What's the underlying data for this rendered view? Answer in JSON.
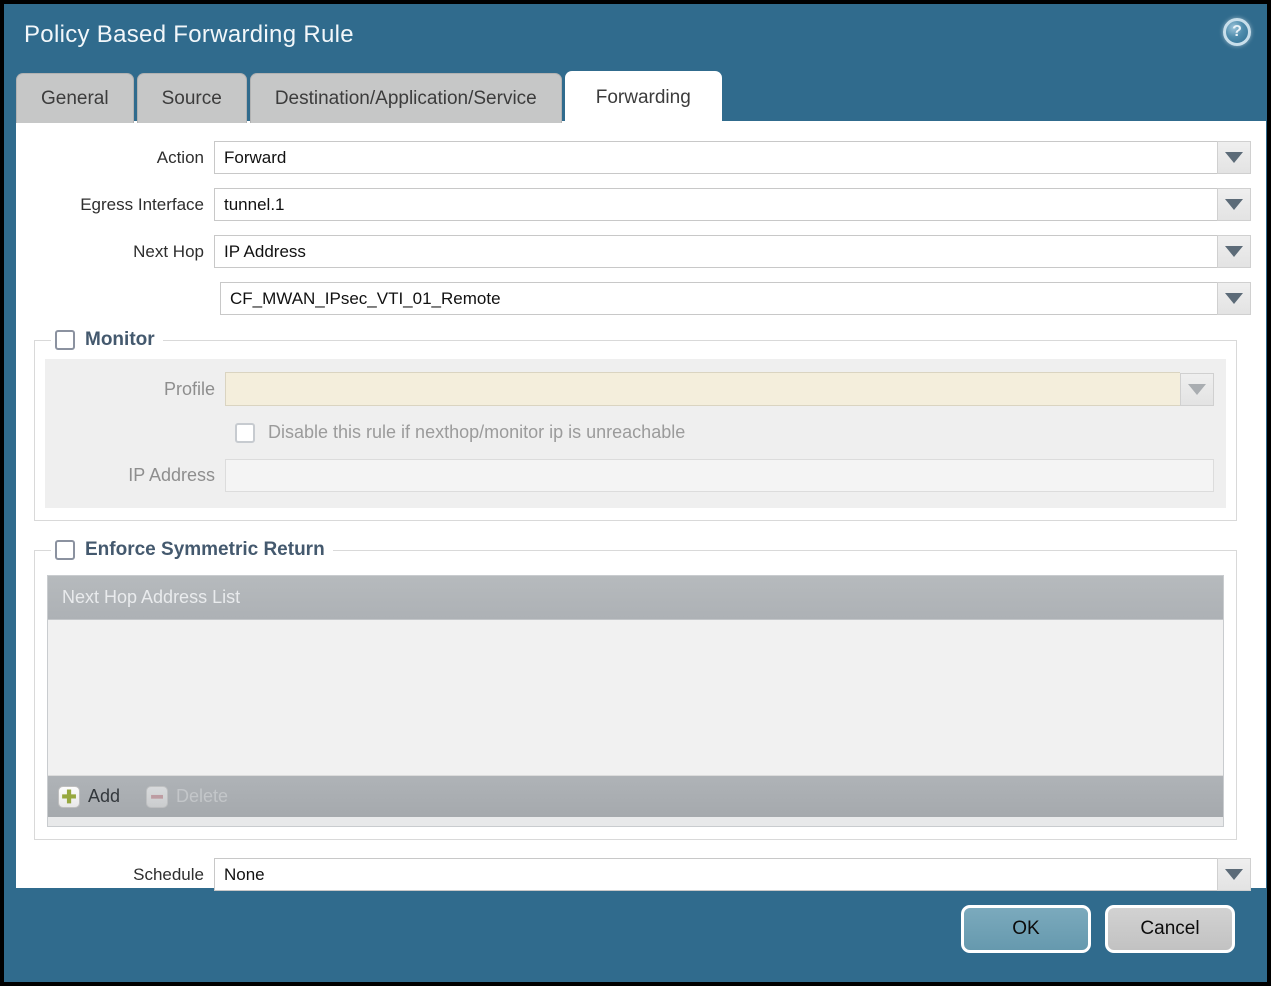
{
  "dialog": {
    "title": "Policy Based Forwarding Rule",
    "help_glyph": "?",
    "tabs": [
      {
        "label": "General",
        "active": false
      },
      {
        "label": "Source",
        "active": false
      },
      {
        "label": "Destination/Application/Service",
        "active": false
      },
      {
        "label": "Forwarding",
        "active": true
      }
    ]
  },
  "form": {
    "action": {
      "label": "Action",
      "value": "Forward"
    },
    "egress_interface": {
      "label": "Egress Interface",
      "value": "tunnel.1"
    },
    "next_hop": {
      "label": "Next Hop",
      "value": "IP Address"
    },
    "next_hop_address": {
      "value": "CF_MWAN_IPsec_VTI_01_Remote"
    },
    "schedule": {
      "label": "Schedule",
      "value": "None"
    }
  },
  "monitor": {
    "legend": "Monitor",
    "checked": false,
    "profile_label": "Profile",
    "profile_value": "",
    "disable_rule_label": "Disable this rule if nexthop/monitor ip is unreachable",
    "disable_rule_checked": false,
    "ip_address_label": "IP Address",
    "ip_address_value": ""
  },
  "symmetric_return": {
    "legend": "Enforce Symmetric Return",
    "checked": false,
    "table_header": "Next Hop Address List",
    "add_label": "Add",
    "delete_label": "Delete",
    "rows": []
  },
  "footer": {
    "ok_label": "OK",
    "cancel_label": "Cancel"
  },
  "colors": {
    "titlebar": "#306B8D",
    "tab_inactive": "#C6C7C7",
    "panel": "#FFFFFF",
    "section_bg": "#EFEFEF",
    "disabled_field": "#F4EEDC",
    "table_header": "#B1B5B9",
    "ok_button": "#6FA3B8",
    "cancel_button": "#CACACA",
    "legend_text": "#44596E"
  }
}
